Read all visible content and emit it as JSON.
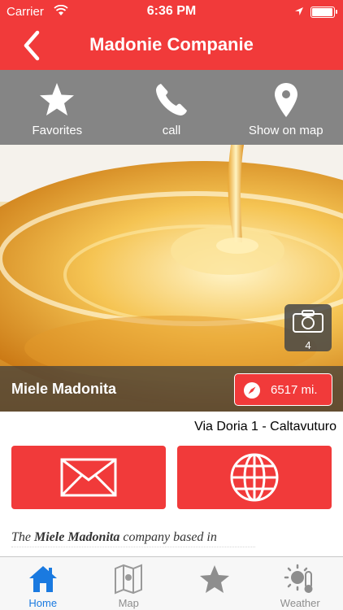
{
  "status_bar": {
    "carrier": "Carrier",
    "time": "6:36 PM",
    "battery_level": 0.95
  },
  "nav": {
    "title": "Madonie Companie",
    "back_icon": "chevron-left-icon"
  },
  "actions": [
    {
      "label": "Favorites",
      "icon": "star-icon"
    },
    {
      "label": "call",
      "icon": "phone-icon"
    },
    {
      "label": "Show on map",
      "icon": "map-pin-icon"
    }
  ],
  "hero": {
    "photo_count": "4",
    "name": "Miele Madonita",
    "distance": "6517 mi."
  },
  "address": "Via Doria 1  - Caltavuturo",
  "contact_buttons": [
    {
      "icon": "envelope-icon"
    },
    {
      "icon": "globe-icon"
    }
  ],
  "description": {
    "prefix": "The",
    "company": "Miele Madonita",
    "suffix": "company based in"
  },
  "tabs": [
    {
      "label": "Home",
      "icon": "home-icon",
      "active": true
    },
    {
      "label": "Map",
      "icon": "map-icon",
      "active": false
    },
    {
      "label": "",
      "icon": "star-icon",
      "active": false
    },
    {
      "label": "Weather",
      "icon": "weather-icon",
      "active": false
    }
  ],
  "colors": {
    "accent": "#f13a3a",
    "action_bar": "#858585",
    "tab_active": "#1a7ae0",
    "tab_inactive": "#8e8e8e"
  }
}
